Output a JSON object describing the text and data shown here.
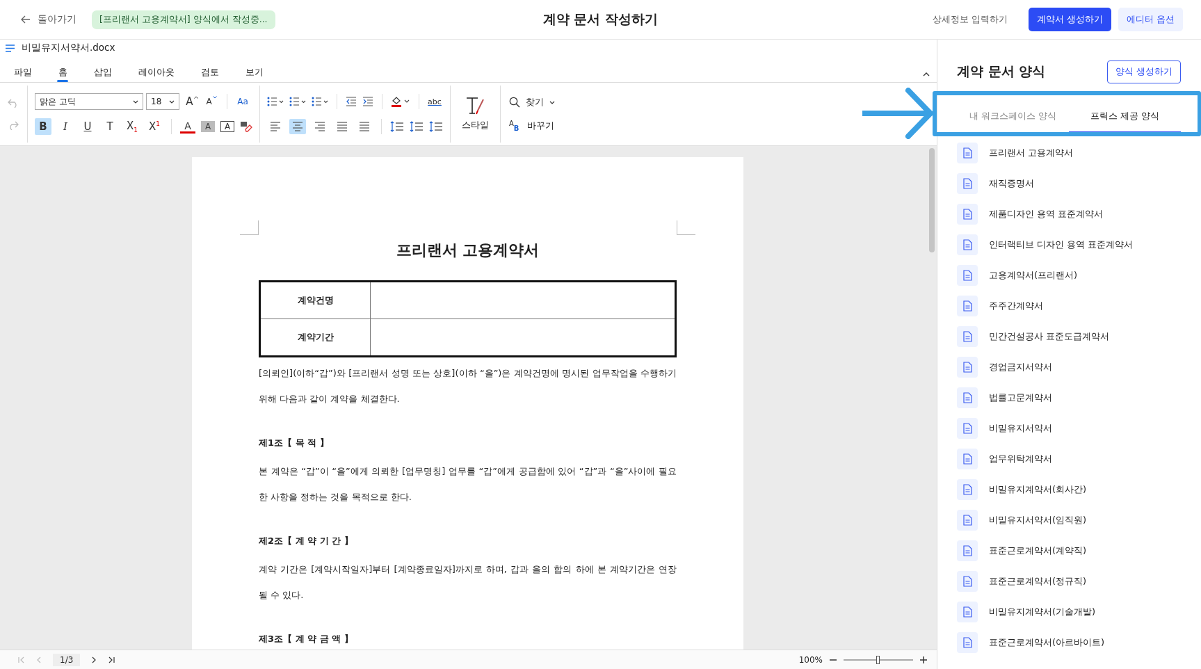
{
  "topbar": {
    "back": "돌아가기",
    "status_badge": "[프리랜서 고용계약서] 양식에서 작성중...",
    "title": "계약 문서 작성하기",
    "actions": [
      {
        "label": "상세정보 입력하기",
        "kind": "text"
      },
      {
        "label": "계약서 생성하기",
        "kind": "primary"
      },
      {
        "label": "에디터 옵션",
        "kind": "secondary"
      }
    ]
  },
  "editor": {
    "filename": "비밀유지서약서.docx",
    "menu_tabs": [
      {
        "label": "파일",
        "selected": false
      },
      {
        "label": "홈",
        "selected": true
      },
      {
        "label": "삽입",
        "selected": false
      },
      {
        "label": "레이아웃",
        "selected": false
      },
      {
        "label": "검토",
        "selected": false
      },
      {
        "label": "보기",
        "selected": false
      }
    ],
    "ribbon": {
      "font": "맑은 고딕",
      "size": "18",
      "grow_label": "A",
      "shrink_label": "A",
      "case_label": "Aa",
      "format_buttons": [
        {
          "label": "B",
          "kind": "bold",
          "selected": true
        },
        {
          "label": "I",
          "kind": "italic",
          "selected": false
        },
        {
          "label": "U",
          "kind": "underline",
          "selected": false
        },
        {
          "label": "T",
          "kind": "strike",
          "selected": false
        },
        {
          "label": "X$_{1}$",
          "kind": "plain",
          "selected": false
        },
        {
          "label": "X$^{1}$",
          "kind": "plain",
          "selected": false
        }
      ],
      "color_buttons": [
        {
          "label": "A",
          "kind": "font-color"
        },
        {
          "label": "A",
          "kind": "shade"
        },
        {
          "label": "A",
          "kind": "boxed"
        }
      ],
      "align_buttons": [
        {
          "kind": "left",
          "selected": false
        },
        {
          "kind": "center",
          "selected": true
        },
        {
          "kind": "right",
          "selected": false
        },
        {
          "kind": "justify",
          "selected": false
        },
        {
          "kind": "distribute",
          "selected": false
        }
      ],
      "spell_label": "abc",
      "style": "스타일",
      "find": "찾기",
      "replace": "바꾸기",
      "replace_letters": [
        "A",
        "B"
      ]
    },
    "document": {
      "title": "프리랜서 고용계약서",
      "table": [
        {
          "label": "계약건명"
        },
        {
          "label": "계약기간"
        }
      ],
      "blocks": [
        {
          "kind": "text",
          "text": "[의뢰인](이하“갑”)와 [프리랜서 성명 또는 상호](이하 “을”)은 계약건명에 명시된 업무작업을 수행하기 위해 다음과 같이 계약을 체결한다."
        },
        {
          "kind": "heading",
          "text": "제1조【 목 적 】"
        },
        {
          "kind": "text",
          "text": "본 계약은 “갑”이 “을”에게 의뢰한 [업무명칭] 업무를 “갑”에게 공급함에 있어 “갑”과 “을”사이에 필요한 사항을 정하는 것을 목적으로 한다."
        },
        {
          "kind": "heading",
          "text": "제2조【 계 약 기 간 】"
        },
        {
          "kind": "text",
          "text": "계약 기간은 [계약시작일자]부터 [계약종료일자]까지로 하며, 갑과 을의 합의 하에 본 계약기간은 연장 될 수 있다."
        },
        {
          "kind": "heading",
          "text": "제3조【 계 약 금 액 】"
        }
      ]
    },
    "status_bar": {
      "page": "1/3",
      "zoom": "100%",
      "zoom_slider": {
        "level": 0.5
      }
    }
  },
  "panel": {
    "title": "계약 문서 양식",
    "create_button": "양식 생성하기",
    "tabs": [
      {
        "label": "내 워크스페이스 양식",
        "selected": false
      },
      {
        "label": "프릭스 제공 양식",
        "selected": true
      }
    ],
    "templates": [
      "프리랜서 고용계약서",
      "재직증명서",
      "제품디자인 용역 표준계약서",
      "인터랙티브 디자인 용역 표준계약서",
      "고용계약서(프리랜서)",
      "주주간계약서",
      "민간건설공사 표준도급계약서",
      "경업금지서약서",
      "법률고문계약서",
      "비밀유지서약서",
      "업무위탁계약서",
      "비밀유지계약서(회사간)",
      "비밀유지서약서(임직원)",
      "표준근로계약서(계약직)",
      "표준근로계약서(정규직)",
      "비밀유지계약서(기술개발)",
      "표준근로계약서(아르바이트)"
    ]
  }
}
